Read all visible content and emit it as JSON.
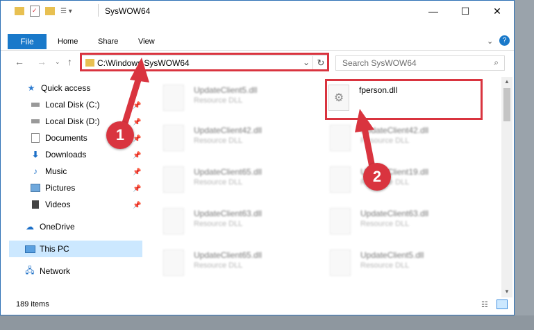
{
  "window": {
    "title": "SysWOW64",
    "controls": {
      "minimize": "—",
      "maximize": "☐",
      "close": "✕"
    }
  },
  "ribbon": {
    "file": "File",
    "tabs": [
      "Home",
      "Share",
      "View"
    ]
  },
  "address": {
    "path": "C:\\Windows\\SysWOW64"
  },
  "search": {
    "placeholder": "Search SysWOW64"
  },
  "sidebar": {
    "items": [
      {
        "label": "Quick access",
        "icon": "star-icon"
      },
      {
        "label": "Local Disk (C:)",
        "icon": "drive-icon"
      },
      {
        "label": "Local Disk (D:)",
        "icon": "drive-icon"
      },
      {
        "label": "Documents",
        "icon": "documents-icon"
      },
      {
        "label": "Downloads",
        "icon": "download-icon"
      },
      {
        "label": "Music",
        "icon": "music-icon"
      },
      {
        "label": "Pictures",
        "icon": "pictures-icon"
      },
      {
        "label": "Videos",
        "icon": "videos-icon"
      },
      {
        "label": "OneDrive",
        "icon": "cloud-icon"
      },
      {
        "label": "This PC",
        "icon": "computer-icon"
      },
      {
        "label": "Network",
        "icon": "network-icon"
      }
    ]
  },
  "files": {
    "left": [
      {
        "name": "UpdateClient5.dll",
        "type": "Resource DLL"
      },
      {
        "name": "UpdateClient42.dll",
        "type": "Resource DLL"
      },
      {
        "name": "UpdateClient65.dll",
        "type": "Resource DLL"
      },
      {
        "name": "UpdateClient63.dll",
        "type": "Resource DLL"
      },
      {
        "name": "UpdateClient65.dll",
        "type": "Resource DLL"
      }
    ],
    "right": [
      {
        "name": "fperson.dll",
        "type": ""
      },
      {
        "name": "UpdateClient42.dll",
        "type": "Resource DLL"
      },
      {
        "name": "UpdateClient19.dll",
        "type": "Resource DLL"
      },
      {
        "name": "UpdateClient63.dll",
        "type": "Resource DLL"
      },
      {
        "name": "UpdateClient5.dll",
        "type": "Resource DLL"
      }
    ]
  },
  "status": {
    "count": "189 items"
  },
  "callouts": {
    "one": "1",
    "two": "2"
  },
  "colors": {
    "accent": "#1979ca",
    "callout": "#d9343f",
    "selected": "#cce8ff"
  }
}
